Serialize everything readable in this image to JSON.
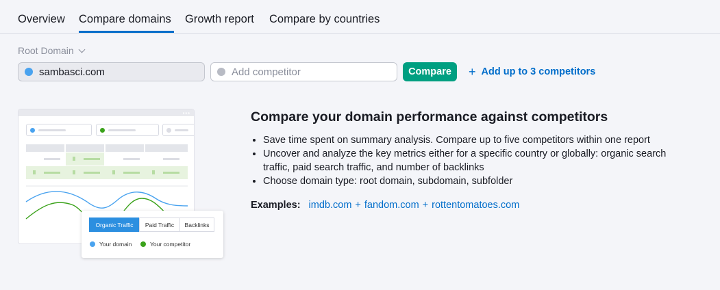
{
  "tabs": [
    {
      "label": "Overview",
      "active": false
    },
    {
      "label": "Compare domains",
      "active": true
    },
    {
      "label": "Growth report",
      "active": false
    },
    {
      "label": "Compare by countries",
      "active": false
    }
  ],
  "form": {
    "domain_type": "Root Domain",
    "domain_value": "sambasci.com",
    "competitor_placeholder": "Add competitor",
    "compare_label": "Compare",
    "add_link": "Add up to 3 competitors"
  },
  "illustration": {
    "segments": [
      "Organic Traffic",
      "Paid Traffic",
      "Backlinks"
    ],
    "legend": [
      "Your domain",
      "Your competitor"
    ]
  },
  "info": {
    "title": "Compare your domain performance against competitors",
    "bullets": [
      "Save time spent on summary analysis. Compare up to five competitors within one report",
      "Uncover and analyze the key metrics either for a specific country or globally: organic search traffic, paid search traffic, and number of backlinks",
      "Choose domain type: root domain, subdomain, subfolder"
    ],
    "examples_label": "Examples:",
    "examples": [
      "imdb.com",
      "fandom.com",
      "rottentomatoes.com"
    ],
    "examples_sep": "+"
  },
  "colors": {
    "accent": "#006dca",
    "compare_button": "#009f81",
    "your_domain": "#4aa3ef",
    "competitor": "#3ba21b"
  }
}
